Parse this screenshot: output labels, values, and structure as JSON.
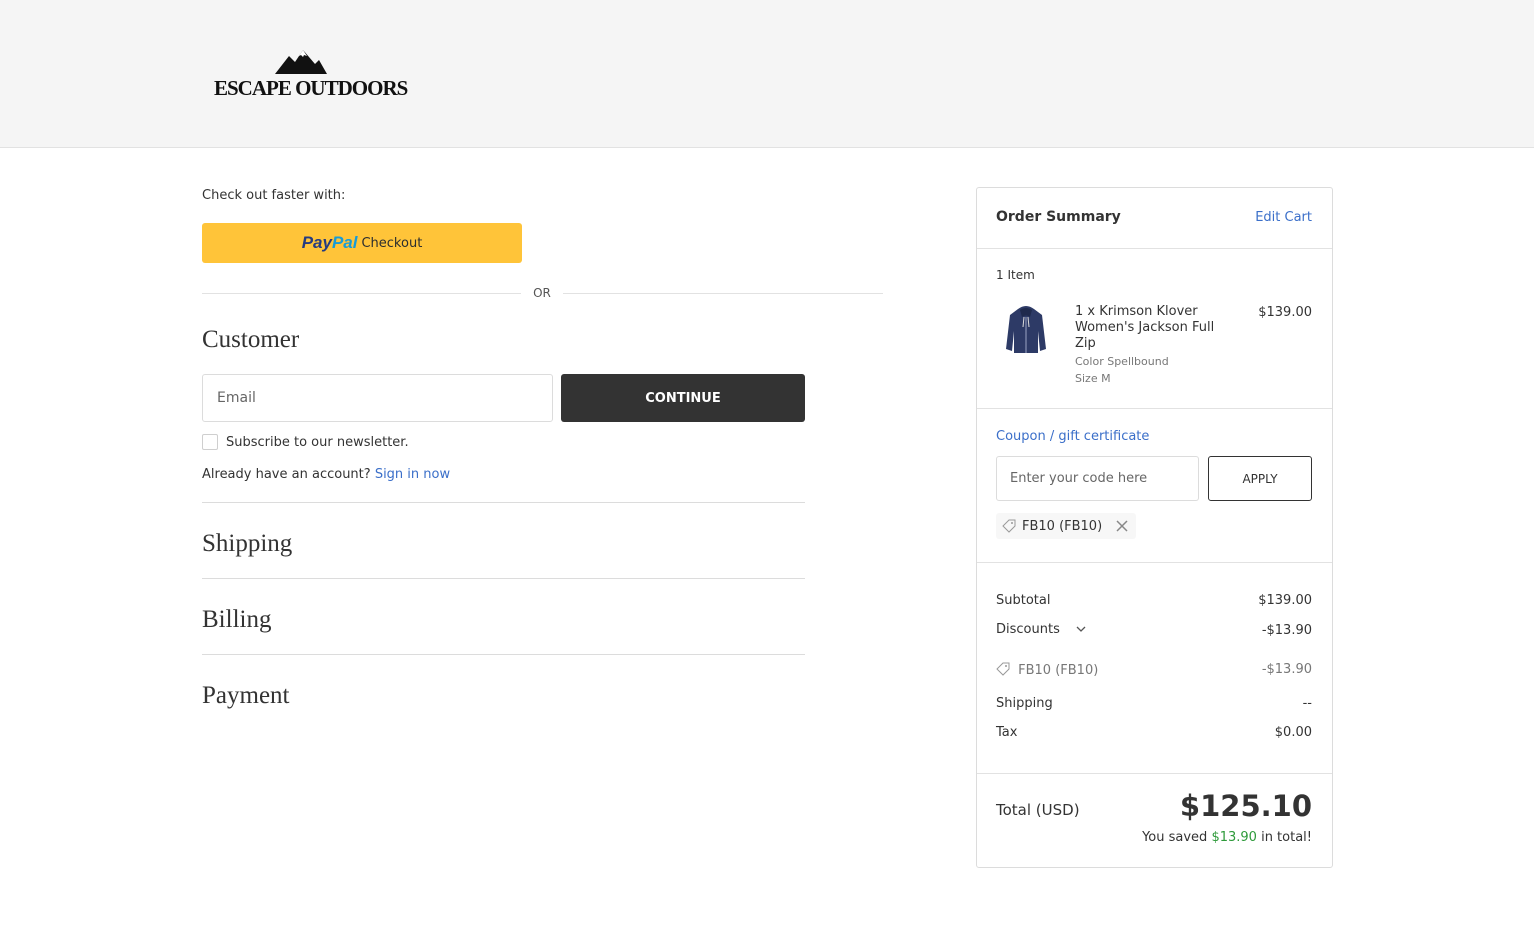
{
  "header": {
    "brand": "ESCAPE OUTDOORS"
  },
  "checkout": {
    "faster_label": "Check out faster with:",
    "paypal": {
      "pay": "Pay",
      "pal": "Pal",
      "checkout": "Checkout"
    },
    "or_label": "OR",
    "customer": {
      "title": "Customer",
      "email_placeholder": "Email",
      "continue_label": "CONTINUE",
      "newsletter_label": "Subscribe to our newsletter.",
      "account_prompt": "Already have an account?",
      "sign_in_label": "Sign in now"
    },
    "shipping_title": "Shipping",
    "billing_title": "Billing",
    "payment_title": "Payment"
  },
  "summary": {
    "title": "Order Summary",
    "edit_cart": "Edit Cart",
    "item_count": "1 Item",
    "product": {
      "name": "1 x Krimson Klover Women's Jackson Full Zip",
      "color": "Color Spellbound",
      "size": "Size M",
      "price": "$139.00",
      "image_icon": "hoodie-icon"
    },
    "coupon": {
      "link_label": "Coupon / gift certificate",
      "placeholder": "Enter your code here",
      "apply_label": "APPLY",
      "applied_code": "FB10 (FB10)"
    },
    "subtotal_label": "Subtotal",
    "subtotal_value": "$139.00",
    "discounts_label": "Discounts",
    "discounts_value": "-$13.90",
    "discount_line_label": "FB10 (FB10)",
    "discount_line_value": "-$13.90",
    "shipping_label": "Shipping",
    "shipping_value": "--",
    "tax_label": "Tax",
    "tax_value": "$0.00",
    "total_label": "Total (USD)",
    "total_value": "$125.10",
    "saved_prefix": "You saved",
    "saved_amount": "$13.90",
    "saved_suffix": "in total!"
  },
  "colors": {
    "header_bg": "#f5f5f5",
    "paypal_yellow": "#ffc439",
    "paypal_dark_blue": "#253b80",
    "paypal_light_blue": "#179bd7",
    "continue_bg": "#333333",
    "link": "#3b6fc9",
    "savings_green": "#2e9a3a"
  }
}
